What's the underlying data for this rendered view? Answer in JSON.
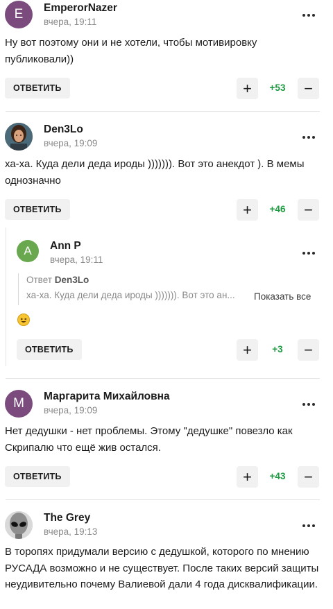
{
  "ui": {
    "reply_label": "ОТВЕТИТЬ",
    "plus_symbol": "+",
    "minus_symbol": "−",
    "reply_to_prefix": "Ответ",
    "show_all_label": "Показать все"
  },
  "colors": {
    "score_green": "#1e9b41",
    "avatar_emperor": "#7b4b7e",
    "avatar_ann": "#6aa84f",
    "avatar_margarita": "#7b4b7e"
  },
  "comments": [
    {
      "author": "EmperorNazer",
      "avatar_letter": "E",
      "time": "вчера, 19:11",
      "text": "Ну вот поэтому они и не хотели, чтобы мотивировку публиковали))",
      "score": "+53"
    },
    {
      "author": "Den3Lo",
      "avatar_icon": "portrait-avatar",
      "time": "вчера, 19:09",
      "text": "ха-ха. Куда дели деда ироды ))))))). Вот это анекдот ). В мемы однозначно",
      "score": "+46"
    },
    {
      "author": "Ann P",
      "avatar_letter": "A",
      "time": "вчера, 19:11",
      "reply_to": "Den3Lo",
      "quote": "ха-ха. Куда дели деда ироды ))))))). Вот это ан...",
      "emoji": "laughing-crying-emoji",
      "score": "+3"
    },
    {
      "author": "Маргарита Михайловна",
      "avatar_letter": "М",
      "time": "вчера, 19:09",
      "text": "Нет дедушки - нет проблемы. Этому \"дедушке\" повезло как Скрипалю что ещё жив остался.",
      "score": "+43"
    },
    {
      "author": "The Grey",
      "avatar_icon": "alien-avatar",
      "time": "вчера, 19:13",
      "text": "В торопях придумали версию с дедушкой, которого по мнению РУСАДА возможно и не существует. После таких версий защиты неудивительно почему Валиевой дали 4 года дисквалификации."
    }
  ]
}
